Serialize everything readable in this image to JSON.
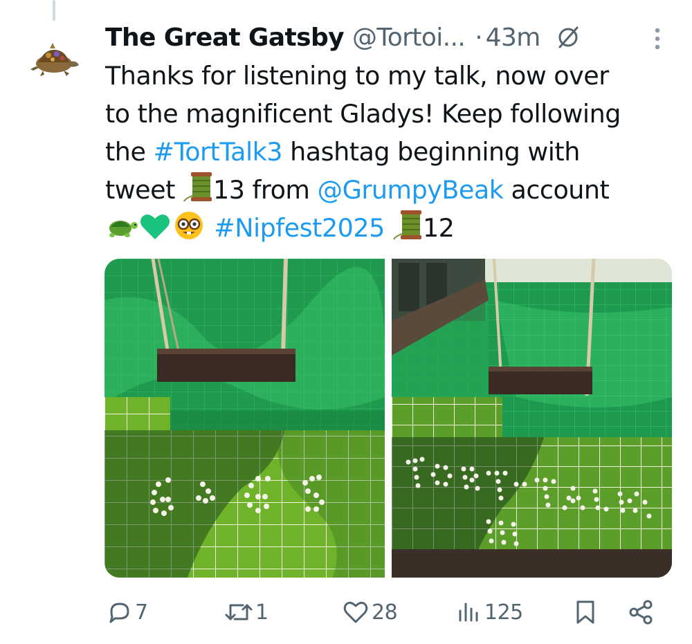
{
  "tweet": {
    "author": {
      "name": "The Great Gatsby",
      "handle": "@Tortoi...",
      "avatar_icon": "tortoise-avatar"
    },
    "dot": "·",
    "time": "43m",
    "text": {
      "line1": "Thanks for listening to my talk, now over",
      "line2": "to the magnificent Gladys! Keep following",
      "line3_pre": "the ",
      "line3_hashtag": "#TortTalk3",
      "line3_post": " hashtag beginning with",
      "line4_pre": "tweet ",
      "line4_number": "13 from ",
      "line4_mention": "@GrumpyBeak",
      "line4_post": " account",
      "line5_hashtag": "#Nipfest2025",
      "line5_number": "12"
    },
    "emojis": [
      "spool-of-thread",
      "turtle",
      "green-heart",
      "nerd-face"
    ],
    "media": [
      {
        "icon": "photo-swing-pool-gigs",
        "caption_in_image": "GIGS"
      },
      {
        "icon": "photo-swing-pool-torttalk",
        "caption_in_image": "TORT TALK III"
      }
    ],
    "stats": {
      "replies": "7",
      "reposts": "1",
      "likes": "28",
      "views": "125"
    }
  },
  "colors": {
    "text": "#0f1419",
    "muted": "#536471",
    "link": "#1d9bf0",
    "pool_green": "#1f9a4f",
    "tile_light": "#8fd43c"
  }
}
